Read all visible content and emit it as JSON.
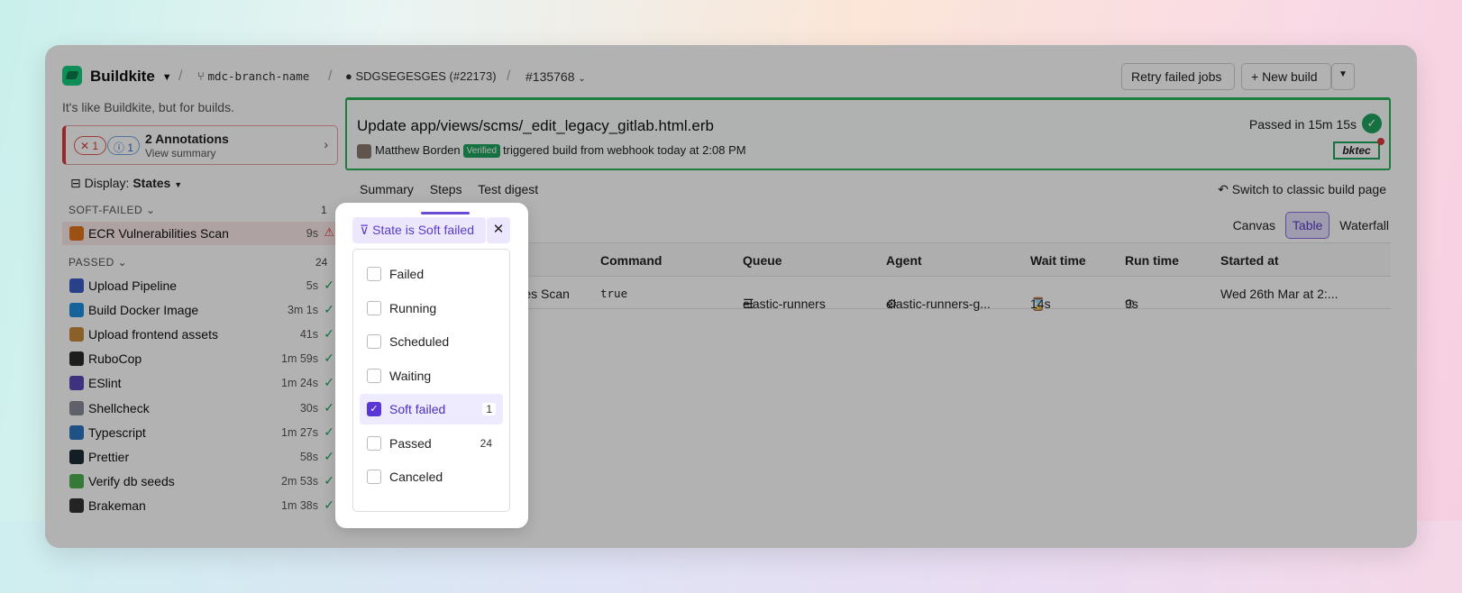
{
  "topbar": {
    "org": "Buildkite",
    "branch": "mdc-branch-name",
    "repo": "SDGSEGESGES (#22173)",
    "build_number": "#135768",
    "retry_label": "Retry failed jobs",
    "new_build_label": "+ New build"
  },
  "tagline": "It's like Buildkite, but for builds.",
  "annotations": {
    "error_count": "1",
    "info_count": "1",
    "title": "2 Annotations",
    "subtitle": "View summary"
  },
  "display": {
    "label": "Display:",
    "value": "States"
  },
  "sections": {
    "soft_failed": {
      "label": "SOFT-FAILED",
      "count": "1"
    },
    "passed": {
      "label": "PASSED",
      "count": "24"
    }
  },
  "soft_failed_steps": [
    {
      "name": "ECR Vulnerabilities Scan",
      "time": "9s",
      "icon": "ecr-icon",
      "color": "#e0731a"
    }
  ],
  "passed_steps": [
    {
      "name": "Upload Pipeline",
      "time": "5s",
      "icon": "upload-pipeline-icon",
      "color": "#3a5ec4"
    },
    {
      "name": "Build Docker Image",
      "time": "3m 1s",
      "icon": "docker-icon",
      "color": "#1d8fe0"
    },
    {
      "name": "Upload frontend assets",
      "time": "41s",
      "icon": "package-icon",
      "color": "#c68a3a"
    },
    {
      "name": "RuboCop",
      "time": "1m 59s",
      "icon": "rubocop-icon",
      "color": "#2a2a2a"
    },
    {
      "name": "ESlint",
      "time": "1m 24s",
      "icon": "eslint-icon",
      "color": "#5a48b8"
    },
    {
      "name": "Shellcheck",
      "time": "30s",
      "icon": "shell-icon",
      "color": "#8a8a9a"
    },
    {
      "name": "Typescript",
      "time": "1m 27s",
      "icon": "typescript-icon",
      "color": "#2f74c0"
    },
    {
      "name": "Prettier",
      "time": "58s",
      "icon": "prettier-icon",
      "color": "#1a2b34"
    },
    {
      "name": "Verify db seeds",
      "time": "2m 53s",
      "icon": "sprout-icon",
      "color": "#4caf50"
    },
    {
      "name": "Brakeman",
      "time": "1m 38s",
      "icon": "brakeman-icon",
      "color": "#333333"
    }
  ],
  "build": {
    "title": "Update app/views/scms/_edit_legacy_gitlab.html.erb",
    "author": "Matthew Borden",
    "verified": "Verified",
    "trigger_text": "triggered build from webhook today at 2:08 PM",
    "status": "Passed in 15m 15s",
    "badge": "bktec"
  },
  "tabs": [
    "Summary",
    "Steps",
    "Test digest"
  ],
  "switch_label": "Switch to classic build page",
  "views": [
    "Canvas",
    "Table",
    "Waterfall"
  ],
  "table": {
    "headers": [
      "Command",
      "Queue",
      "Agent",
      "Wait time",
      "Run time",
      "Started at"
    ],
    "row": {
      "name": "ECR Vulnerabilities Scan",
      "name_visible": "ilities Scan",
      "command": "true",
      "queue": "elastic-runners",
      "agent": "elastic-runners-g...",
      "wait": "14s",
      "run": "9s",
      "started": "Wed 26th Mar at 2:..."
    }
  },
  "filter": {
    "chip_label": "State is Soft failed",
    "options": [
      {
        "label": "Failed",
        "checked": false,
        "count": ""
      },
      {
        "label": "Running",
        "checked": false,
        "count": ""
      },
      {
        "label": "Scheduled",
        "checked": false,
        "count": ""
      },
      {
        "label": "Waiting",
        "checked": false,
        "count": ""
      },
      {
        "label": "Soft failed",
        "checked": true,
        "count": "1"
      },
      {
        "label": "Passed",
        "checked": false,
        "count": "24"
      },
      {
        "label": "Canceled",
        "checked": false,
        "count": ""
      }
    ]
  }
}
